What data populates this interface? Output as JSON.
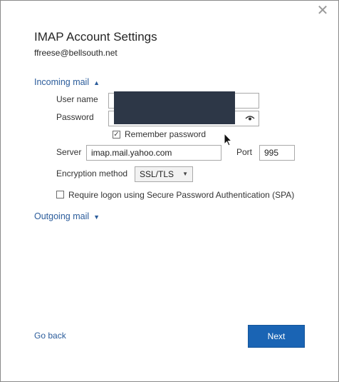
{
  "dialog": {
    "title": "IMAP Account Settings",
    "email": "ffreese@bellsouth.net",
    "close_icon": "close-icon"
  },
  "incoming": {
    "toggle_label": "Incoming mail",
    "expanded": true,
    "username_label": "User name",
    "password_label": "Password",
    "remember_password_label": "Remember password",
    "remember_password_checked": true,
    "server_label": "Server",
    "server_value": "imap.mail.yahoo.com",
    "port_label": "Port",
    "port_value": "995",
    "encryption_label": "Encryption method",
    "encryption_value": "SSL/TLS",
    "spa_label": "Require logon using Secure Password Authentication (SPA)",
    "spa_checked": false
  },
  "outgoing": {
    "toggle_label": "Outgoing mail",
    "expanded": false
  },
  "footer": {
    "go_back_label": "Go back",
    "next_label": "Next"
  },
  "colors": {
    "accent": "#1a64b4",
    "link": "#2b5c9b",
    "redaction": "#2d3747"
  }
}
